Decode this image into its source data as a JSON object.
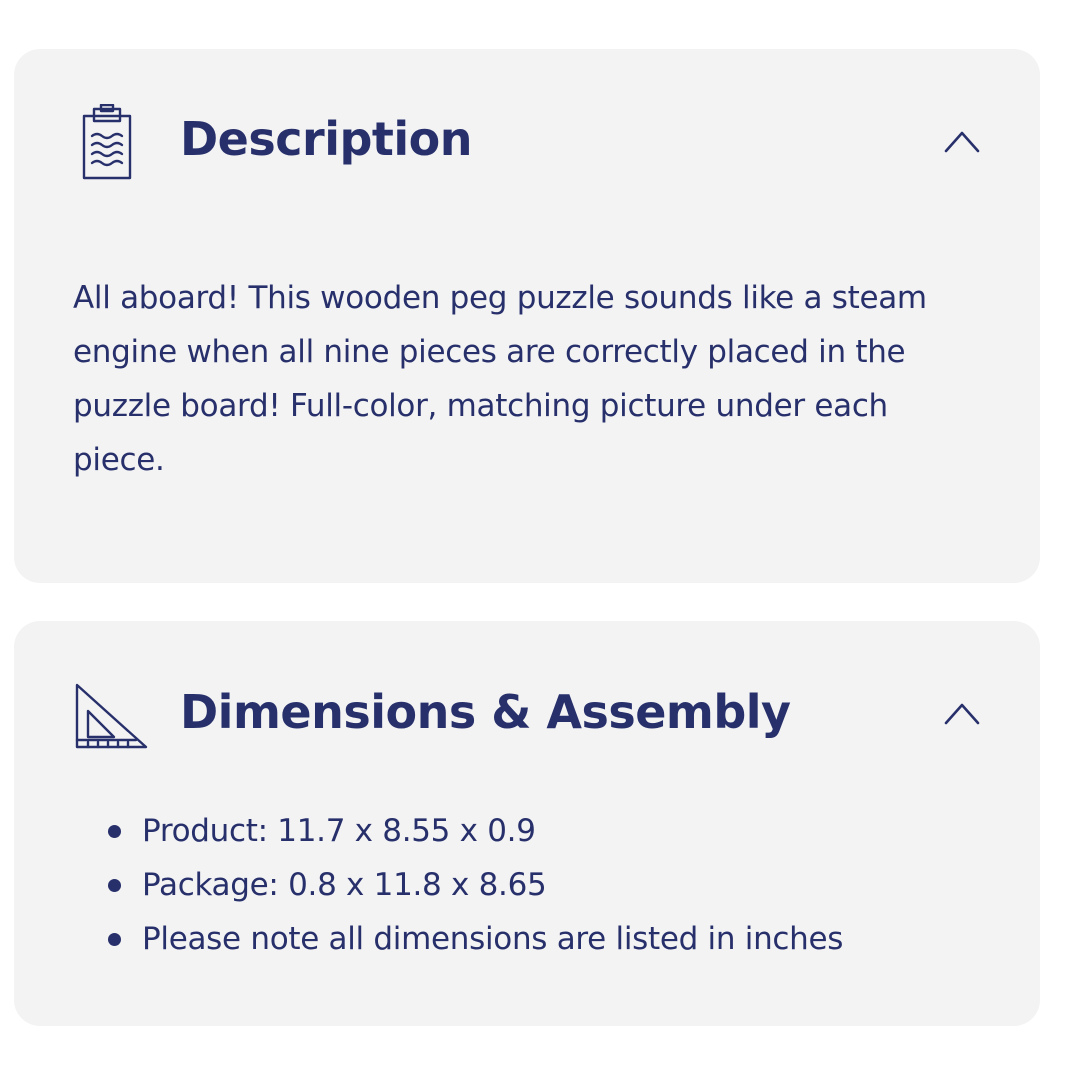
{
  "description_section": {
    "icon": "clipboard-icon",
    "title": "Description",
    "expanded": true,
    "toggle_icon": "chevron-up-icon",
    "body": "All aboard! This wooden peg puzzle sounds like a steam engine when all nine pieces are correctly placed in the puzzle board! Full-color, matching picture under each piece."
  },
  "dimensions_section": {
    "icon": "set-square-icon",
    "title": "Dimensions & Assembly",
    "expanded": true,
    "toggle_icon": "chevron-up-icon",
    "items": [
      {
        "text": "Product: 11.7 x 8.55 x 0.9"
      },
      {
        "text": "Package: 0.8 x 11.8 x 8.65"
      },
      {
        "text": "Please note all dimensions are listed in inches"
      }
    ]
  },
  "colors": {
    "text": "#27306b",
    "card_background": "#f3f3f4",
    "page_background": "#ffffff"
  }
}
